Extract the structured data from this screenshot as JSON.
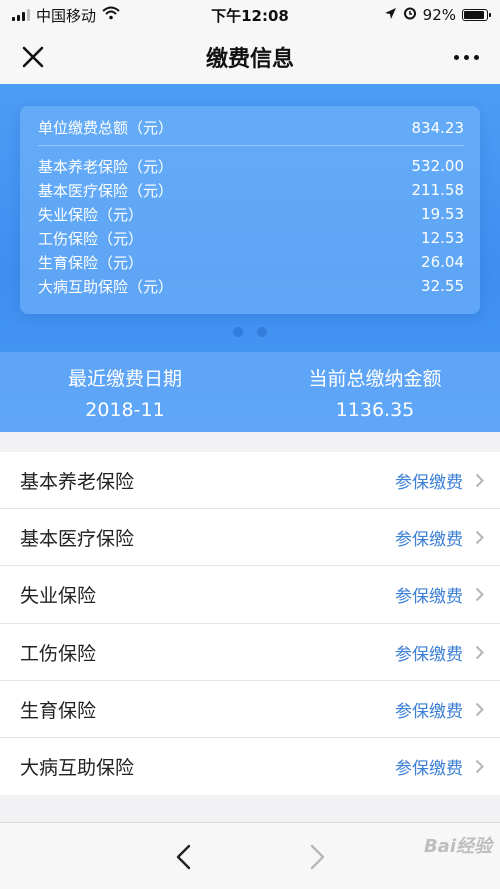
{
  "status_bar": {
    "carrier": "中国移动",
    "time": "下午12:08",
    "battery": "92%"
  },
  "nav": {
    "title": "缴费信息"
  },
  "card": {
    "total_label": "单位缴费总额（元）",
    "total_value": "834.23",
    "rows": [
      {
        "label": "基本养老保险（元）",
        "value": "532.00"
      },
      {
        "label": "基本医疗保险（元）",
        "value": "211.58"
      },
      {
        "label": "失业保险（元）",
        "value": "19.53"
      },
      {
        "label": "工伤保险（元）",
        "value": "12.53"
      },
      {
        "label": "生育保险（元）",
        "value": "26.04"
      },
      {
        "label": "大病互助保险（元）",
        "value": "32.55"
      }
    ]
  },
  "summary": {
    "recent_date_label": "最近缴费日期",
    "recent_date_value": "2018-11",
    "total_label": "当前总缴纳金额",
    "total_value": "1136.35"
  },
  "list": [
    {
      "name": "基本养老保险",
      "link": "参保缴费"
    },
    {
      "name": "基本医疗保险",
      "link": "参保缴费"
    },
    {
      "name": "失业保险",
      "link": "参保缴费"
    },
    {
      "name": "工伤保险",
      "link": "参保缴费"
    },
    {
      "name": "生育保险",
      "link": "参保缴费"
    },
    {
      "name": "大病互助保险",
      "link": "参保缴费"
    }
  ],
  "watermark": "Bai经验",
  "icons": {
    "close": "close-icon",
    "more": "more-icon",
    "back": "chevron-left-icon",
    "forward": "chevron-right-icon"
  },
  "colors": {
    "accent": "#3b7fd6",
    "header_blue": "#4193f2"
  }
}
